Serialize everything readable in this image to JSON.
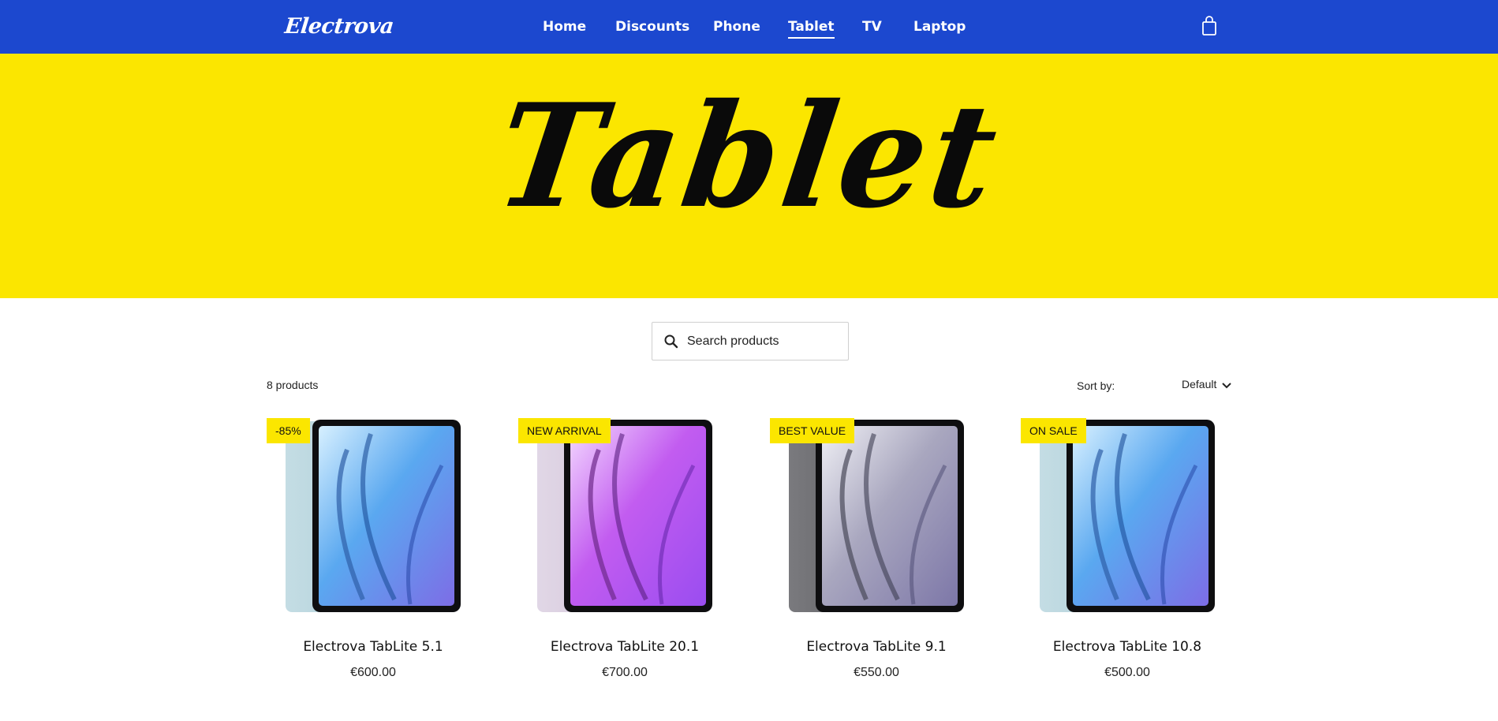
{
  "header": {
    "logo": "Electrova",
    "nav": [
      {
        "label": "Home"
      },
      {
        "label": "Discounts"
      },
      {
        "label": "Phone"
      },
      {
        "label": "Tablet"
      },
      {
        "label": "TV"
      },
      {
        "label": "Laptop"
      }
    ],
    "active_nav": "Tablet",
    "cart_icon": "shopping-bag-icon"
  },
  "hero": {
    "title": "Tablet",
    "background": "#fbe600"
  },
  "colors": {
    "brand": "#1c48cf",
    "accent": "#fbe600"
  },
  "search": {
    "placeholder": "Search products",
    "value": "",
    "icon": "search-icon"
  },
  "listing": {
    "count": "8 products",
    "sort_label": "Sort by:",
    "sort_value": "Default"
  },
  "products": [
    {
      "badge": "-85%",
      "name": "Electrova TabLite 5.1",
      "price": "€600.00",
      "color": "blue"
    },
    {
      "badge": "NEW ARRIVAL",
      "name": "Electrova TabLite 20.1",
      "price": "€700.00",
      "color": "purple"
    },
    {
      "badge": "BEST VALUE",
      "name": "Electrova TabLite 9.1",
      "price": "€550.00",
      "color": "space-gray"
    },
    {
      "badge": "ON SALE",
      "name": "Electrova TabLite 10.8",
      "price": "€500.00",
      "color": "blue"
    }
  ]
}
